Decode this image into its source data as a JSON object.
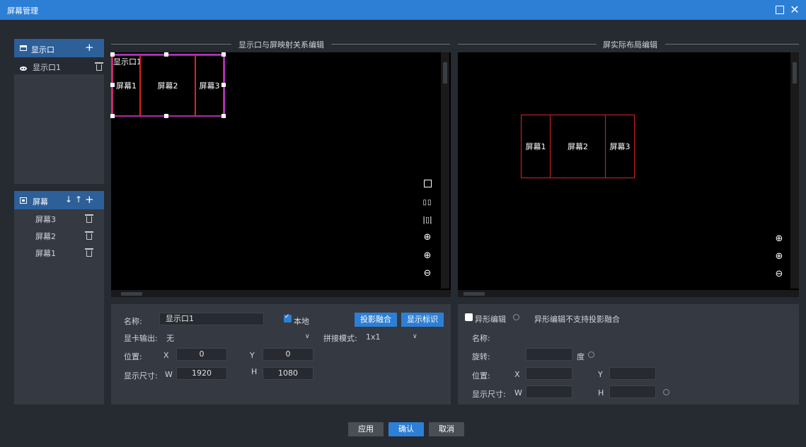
{
  "window": {
    "title": "屏幕管理",
    "max_icon": "maximize-icon",
    "close_icon": "close-icon",
    "close_glyph": "✕"
  },
  "left_panel": {
    "windows_header": "显示口",
    "windows": [
      {
        "label": "显示口1"
      }
    ],
    "screens_header": "屏幕",
    "screens": [
      {
        "label": "屏幕3"
      },
      {
        "label": "屏幕2"
      },
      {
        "label": "屏幕1"
      }
    ],
    "add_glyph": "+",
    "down_glyph": "↓",
    "up_glyph": "↑"
  },
  "mapping_editor": {
    "title": "显示口与屏映射关系编辑",
    "window_label": "显示口1",
    "screens": [
      "屏幕1",
      "屏幕2",
      "屏幕3"
    ],
    "tools": [
      "single-window-icon",
      "two-split-icon",
      "three-split-icon",
      "center-target-icon",
      "zoom-in-icon",
      "zoom-out-icon"
    ]
  },
  "layout_editor": {
    "title": "屏实际布局编辑",
    "screens": [
      "屏幕1",
      "屏幕2",
      "屏幕3"
    ],
    "tools": [
      "center-target-icon",
      "zoom-in-icon",
      "zoom-out-icon"
    ]
  },
  "left_form": {
    "name_label": "名称:",
    "name_value": "显示口1",
    "local_label": "本地",
    "local_checked": true,
    "projection_blend_btn": "投影融合",
    "show_id_btn": "显示标识",
    "gpu_output_label": "显卡输出:",
    "gpu_output_value": "无",
    "splice_mode_label": "拼接模式:",
    "splice_mode_value": "1x1",
    "position_label": "位置:",
    "x_label": "X",
    "x_value": "0",
    "y_label": "Y",
    "y_value": "0",
    "size_label": "显示尺寸:",
    "w_label": "W",
    "w_value": "1920",
    "h_label": "H",
    "h_value": "1080"
  },
  "right_form": {
    "shaped_edit_label": "异形编辑",
    "shaped_edit_checked": false,
    "shaped_note": "异形编辑不支持投影融合",
    "name_label": "名称:",
    "rotate_label": "旋转:",
    "degree_label": "度",
    "position_label": "位置:",
    "x_label": "X",
    "y_label": "Y",
    "size_label": "显示尺寸:",
    "w_label": "W",
    "h_label": "H"
  },
  "footer": {
    "apply": "应用",
    "confirm": "确认",
    "cancel": "取消"
  }
}
